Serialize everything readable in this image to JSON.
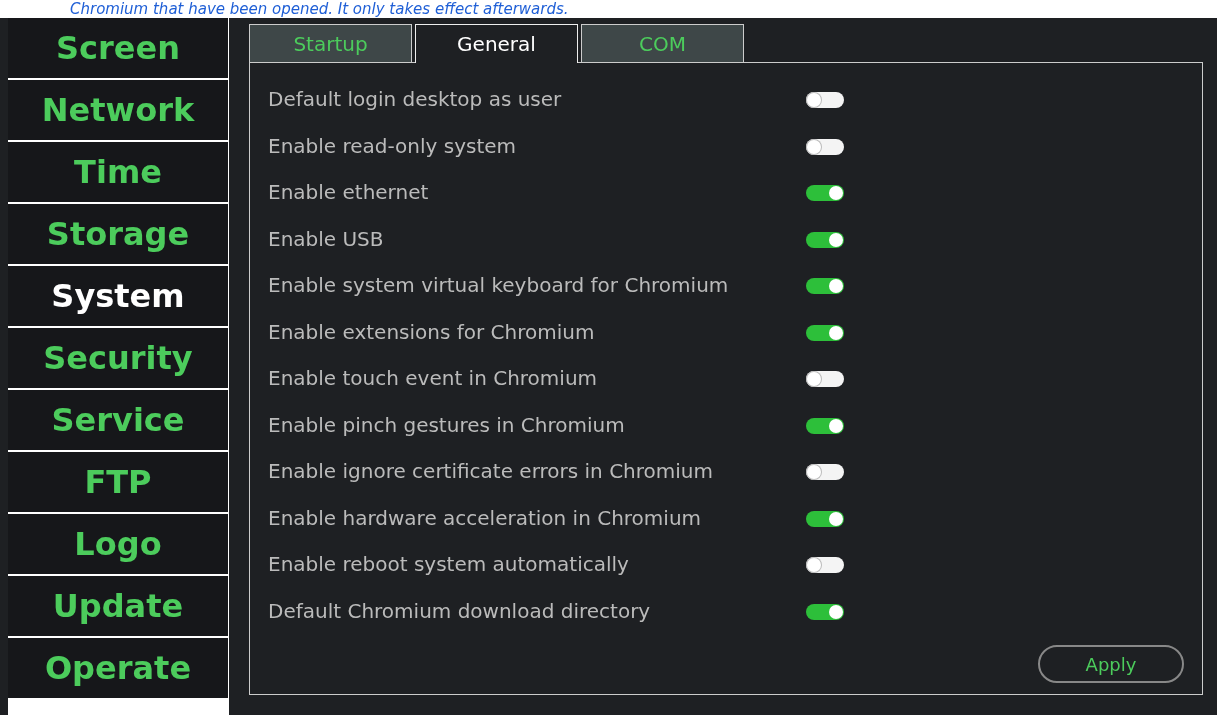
{
  "notice": {
    "text": "Chromium that have been opened. It only takes effect afterwards."
  },
  "sidebar": {
    "items": [
      {
        "label": "Screen",
        "selected": false
      },
      {
        "label": "Network",
        "selected": false
      },
      {
        "label": "Time",
        "selected": false
      },
      {
        "label": "Storage",
        "selected": false
      },
      {
        "label": "System",
        "selected": true
      },
      {
        "label": "Security",
        "selected": false
      },
      {
        "label": "Service",
        "selected": false
      },
      {
        "label": "FTP",
        "selected": false
      },
      {
        "label": "Logo",
        "selected": false
      },
      {
        "label": "Update",
        "selected": false
      },
      {
        "label": "Operate",
        "selected": false
      }
    ]
  },
  "tabs": [
    {
      "label": "Startup",
      "selected": false
    },
    {
      "label": "General",
      "selected": true
    },
    {
      "label": "COM",
      "selected": false
    }
  ],
  "settings": [
    {
      "label": "Default login desktop as user",
      "on": false
    },
    {
      "label": "Enable read-only system",
      "on": false
    },
    {
      "label": "Enable ethernet",
      "on": true
    },
    {
      "label": "Enable USB",
      "on": true
    },
    {
      "label": "Enable system virtual keyboard for Chromium",
      "on": true
    },
    {
      "label": "Enable extensions for Chromium",
      "on": true
    },
    {
      "label": "Enable touch event in Chromium",
      "on": false
    },
    {
      "label": "Enable pinch gestures in Chromium",
      "on": true
    },
    {
      "label": "Enable ignore certificate errors in Chromium",
      "on": false
    },
    {
      "label": "Enable hardware acceleration in Chromium",
      "on": true
    },
    {
      "label": "Enable reboot system automatically",
      "on": false
    },
    {
      "label": "Default Chromium download directory",
      "on": true
    }
  ],
  "apply_button": {
    "label": "Apply"
  }
}
